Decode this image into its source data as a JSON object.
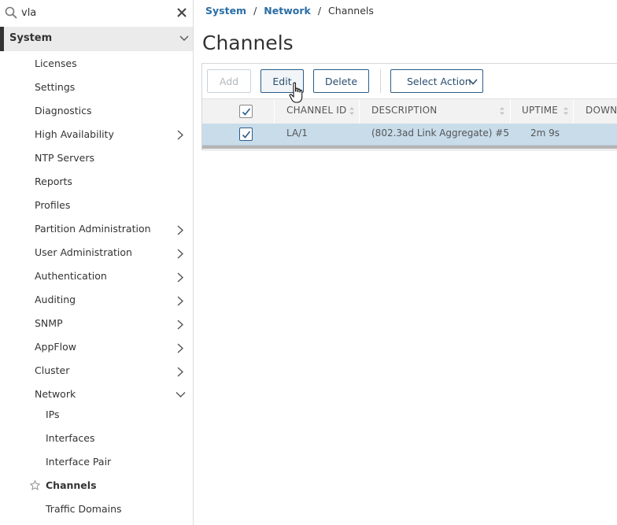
{
  "search": {
    "value": "vla"
  },
  "sidebar": {
    "section": "System",
    "items": [
      {
        "label": "Licenses"
      },
      {
        "label": "Settings"
      },
      {
        "label": "Diagnostics"
      },
      {
        "label": "High Availability"
      },
      {
        "label": "NTP Servers"
      },
      {
        "label": "Reports"
      },
      {
        "label": "Profiles"
      },
      {
        "label": "Partition Administration"
      },
      {
        "label": "User Administration"
      },
      {
        "label": "Authentication"
      },
      {
        "label": "Auditing"
      },
      {
        "label": "SNMP"
      },
      {
        "label": "AppFlow"
      },
      {
        "label": "Cluster"
      },
      {
        "label": "Network"
      }
    ],
    "network_children": [
      {
        "label": "IPs"
      },
      {
        "label": "Interfaces"
      },
      {
        "label": "Interface Pair"
      },
      {
        "label": "Channels"
      },
      {
        "label": "Traffic Domains"
      }
    ]
  },
  "breadcrumb": {
    "level1": "System",
    "sep": "/",
    "level2": "Network",
    "current": "Channels"
  },
  "page": {
    "title": "Channels"
  },
  "toolbar": {
    "add": "Add",
    "edit": "Edit",
    "delete": "Delete",
    "select_action": "Select Action"
  },
  "table": {
    "columns": [
      "CHANNEL ID",
      "DESCRIPTION",
      "UPTIME",
      "DOWNT"
    ],
    "rows": [
      {
        "channel_id": "LA/1",
        "description": "(802.3ad Link Aggregate) #5",
        "uptime": "2m 9s",
        "selected": true
      }
    ]
  },
  "colors": {
    "accent": "#2a6ea6",
    "selected_row": "#c8dcea",
    "header_bg": "#f2f2f2"
  }
}
